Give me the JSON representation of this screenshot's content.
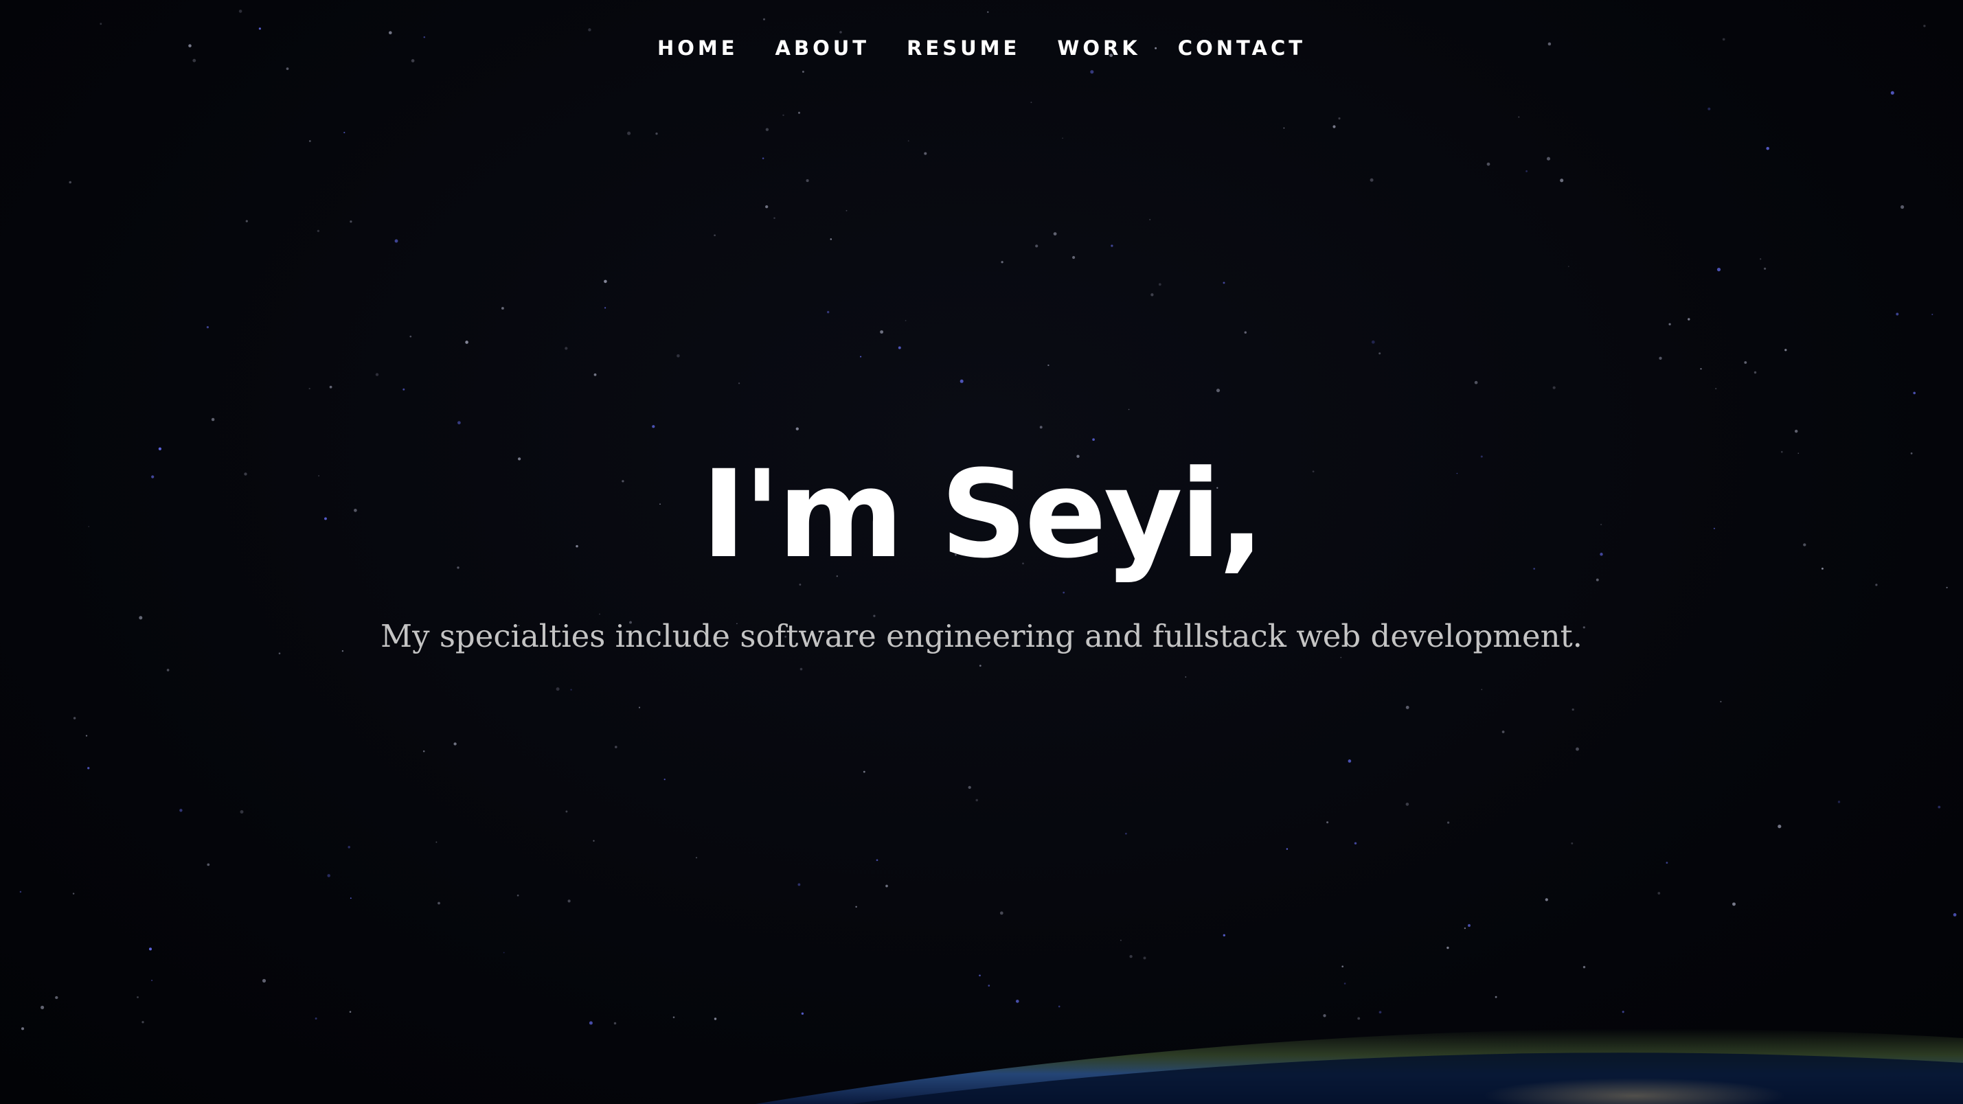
{
  "nav": {
    "items": [
      {
        "label": "HOME"
      },
      {
        "label": "ABOUT"
      },
      {
        "label": "RESUME"
      },
      {
        "label": "WORK"
      },
      {
        "label": "CONTACT"
      }
    ]
  },
  "hero": {
    "headline": "I'm Seyi,",
    "subtitle": "My specialties include software engineering and fullstack web development.",
    "background_image": "night sky with stars above Earth's horizon"
  },
  "colors": {
    "background": "#05060a",
    "nav_text": "#ffffff",
    "headline_text": "#ffffff",
    "subtitle_text": "#c4c4c4",
    "star": "#8a8fb8",
    "horizon_blue": "#2a5aa8",
    "horizon_green": "#5a7a3a"
  }
}
